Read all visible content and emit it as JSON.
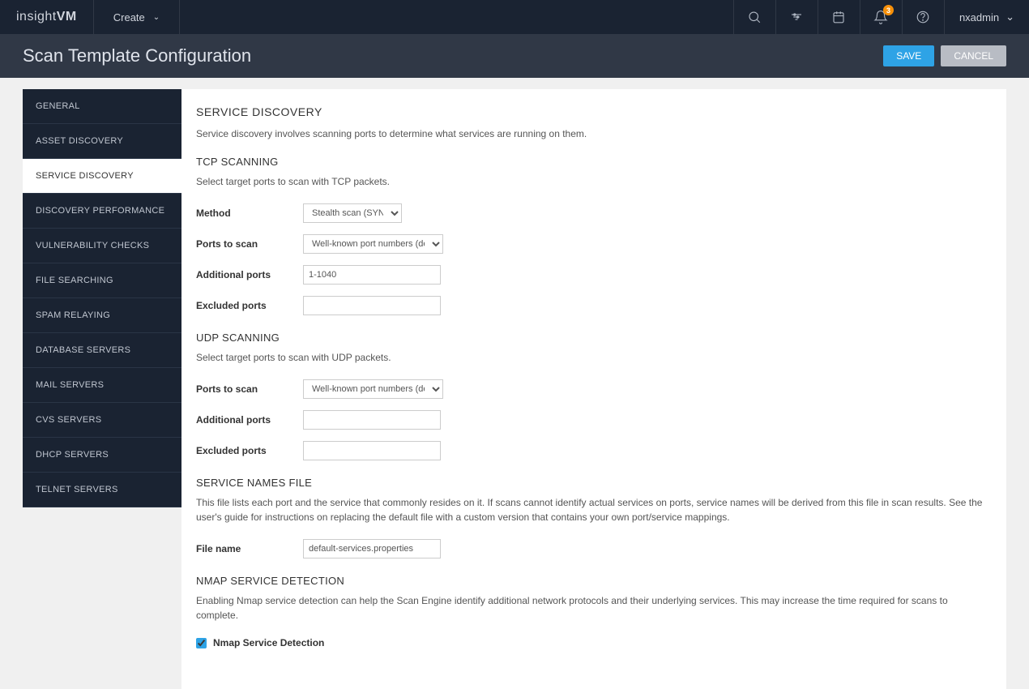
{
  "header": {
    "logo_light": "insight",
    "logo_bold": "VM",
    "create_label": "Create",
    "notification_count": "3",
    "username": "nxadmin"
  },
  "page": {
    "title": "Scan Template Configuration",
    "save_label": "SAVE",
    "cancel_label": "CANCEL"
  },
  "sidebar": {
    "items": [
      {
        "label": "GENERAL"
      },
      {
        "label": "ASSET DISCOVERY"
      },
      {
        "label": "SERVICE DISCOVERY"
      },
      {
        "label": "DISCOVERY PERFORMANCE"
      },
      {
        "label": "VULNERABILITY CHECKS"
      },
      {
        "label": "FILE SEARCHING"
      },
      {
        "label": "SPAM RELAYING"
      },
      {
        "label": "DATABASE SERVERS"
      },
      {
        "label": "MAIL SERVERS"
      },
      {
        "label": "CVS SERVERS"
      },
      {
        "label": "DHCP SERVERS"
      },
      {
        "label": "TELNET SERVERS"
      }
    ],
    "active_index": 2
  },
  "content": {
    "service_discovery": {
      "title": "SERVICE DISCOVERY",
      "desc": "Service discovery involves scanning ports to determine what services are running on them."
    },
    "tcp": {
      "title": "TCP SCANNING",
      "desc": "Select target ports to scan with TCP packets.",
      "method_label": "Method",
      "method_value": "Stealth scan (SYN)",
      "ports_label": "Ports to scan",
      "ports_value": "Well-known port numbers (default)",
      "additional_label": "Additional ports",
      "additional_value": "1-1040",
      "excluded_label": "Excluded ports",
      "excluded_value": ""
    },
    "udp": {
      "title": "UDP SCANNING",
      "desc": "Select target ports to scan with UDP packets.",
      "ports_label": "Ports to scan",
      "ports_value": "Well-known port numbers (default)",
      "additional_label": "Additional ports",
      "additional_value": "",
      "excluded_label": "Excluded ports",
      "excluded_value": ""
    },
    "service_names": {
      "title": "SERVICE NAMES FILE",
      "desc": "This file lists each port and the service that commonly resides on it. If scans cannot identify actual services on ports, service names will be derived from this file in scan results. See the user's guide for instructions on replacing the default file with a custom version that contains your own port/service mappings.",
      "filename_label": "File name",
      "filename_value": "default-services.properties"
    },
    "nmap": {
      "title": "NMAP SERVICE DETECTION",
      "desc": "Enabling Nmap service detection can help the Scan Engine identify additional network protocols and their underlying services. This may increase the time required for scans to complete.",
      "checkbox_label": "Nmap Service Detection",
      "checked": true
    }
  }
}
